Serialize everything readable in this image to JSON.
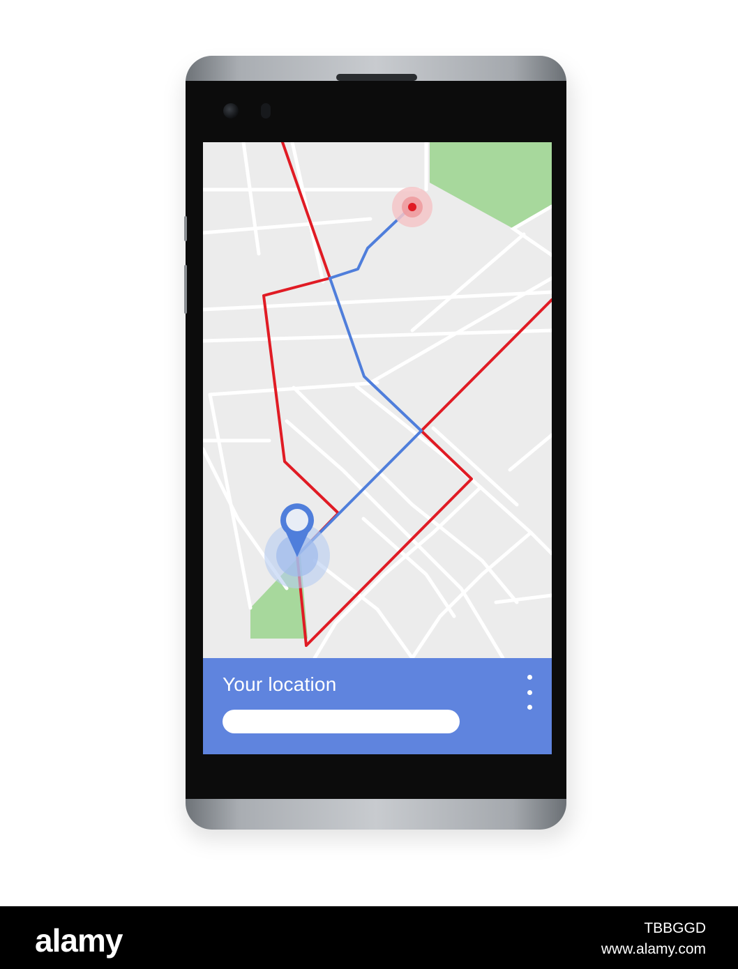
{
  "panel": {
    "title": "Your location",
    "search_value": "",
    "more_icon": "more-vertical-icon"
  },
  "map": {
    "icons": [
      "destination-marker-icon",
      "location-pin-icon"
    ],
    "colors": {
      "background": "#ececec",
      "street": "#ffffff",
      "park": "#a7d89c",
      "red_route": "#e01b24",
      "blue_route": "#4f7edb",
      "panel": "#5f84de"
    }
  },
  "footer": {
    "logo": "alamy",
    "image_id": "TBBGGD",
    "url": "www.alamy.com"
  }
}
